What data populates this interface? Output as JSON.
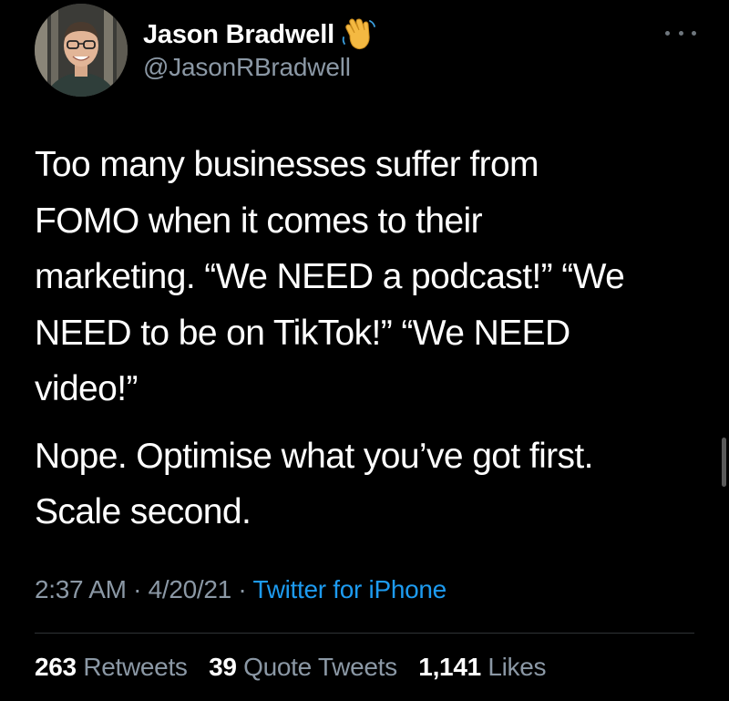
{
  "user": {
    "display_name": "Jason Bradwell",
    "handle": "@JasonRBradwell",
    "badge_icon": "waving-hand-icon"
  },
  "tweet": {
    "paragraph_1": "Too many businesses suffer from\nFOMO when it comes to their\nmarketing. “We NEED a podcast!” “We\nNEED to be on TikTok!” “We NEED\nvideo!”",
    "paragraph_2": "Nope. Optimise what you’ve got first.\nScale second."
  },
  "meta": {
    "time": "2:37 AM",
    "separator": " · ",
    "date": "4/20/21",
    "source": "Twitter for iPhone"
  },
  "stats": {
    "retweets_count": "263",
    "retweets_label": "Retweets",
    "quote_tweets_count": "39",
    "quote_tweets_label": "Quote Tweets",
    "likes_count": "1,141",
    "likes_label": "Likes"
  },
  "colors": {
    "background": "#000000",
    "text_primary": "#ffffff",
    "text_secondary": "#8b98a5",
    "link": "#1d9bf0",
    "divider": "#2f3336"
  }
}
